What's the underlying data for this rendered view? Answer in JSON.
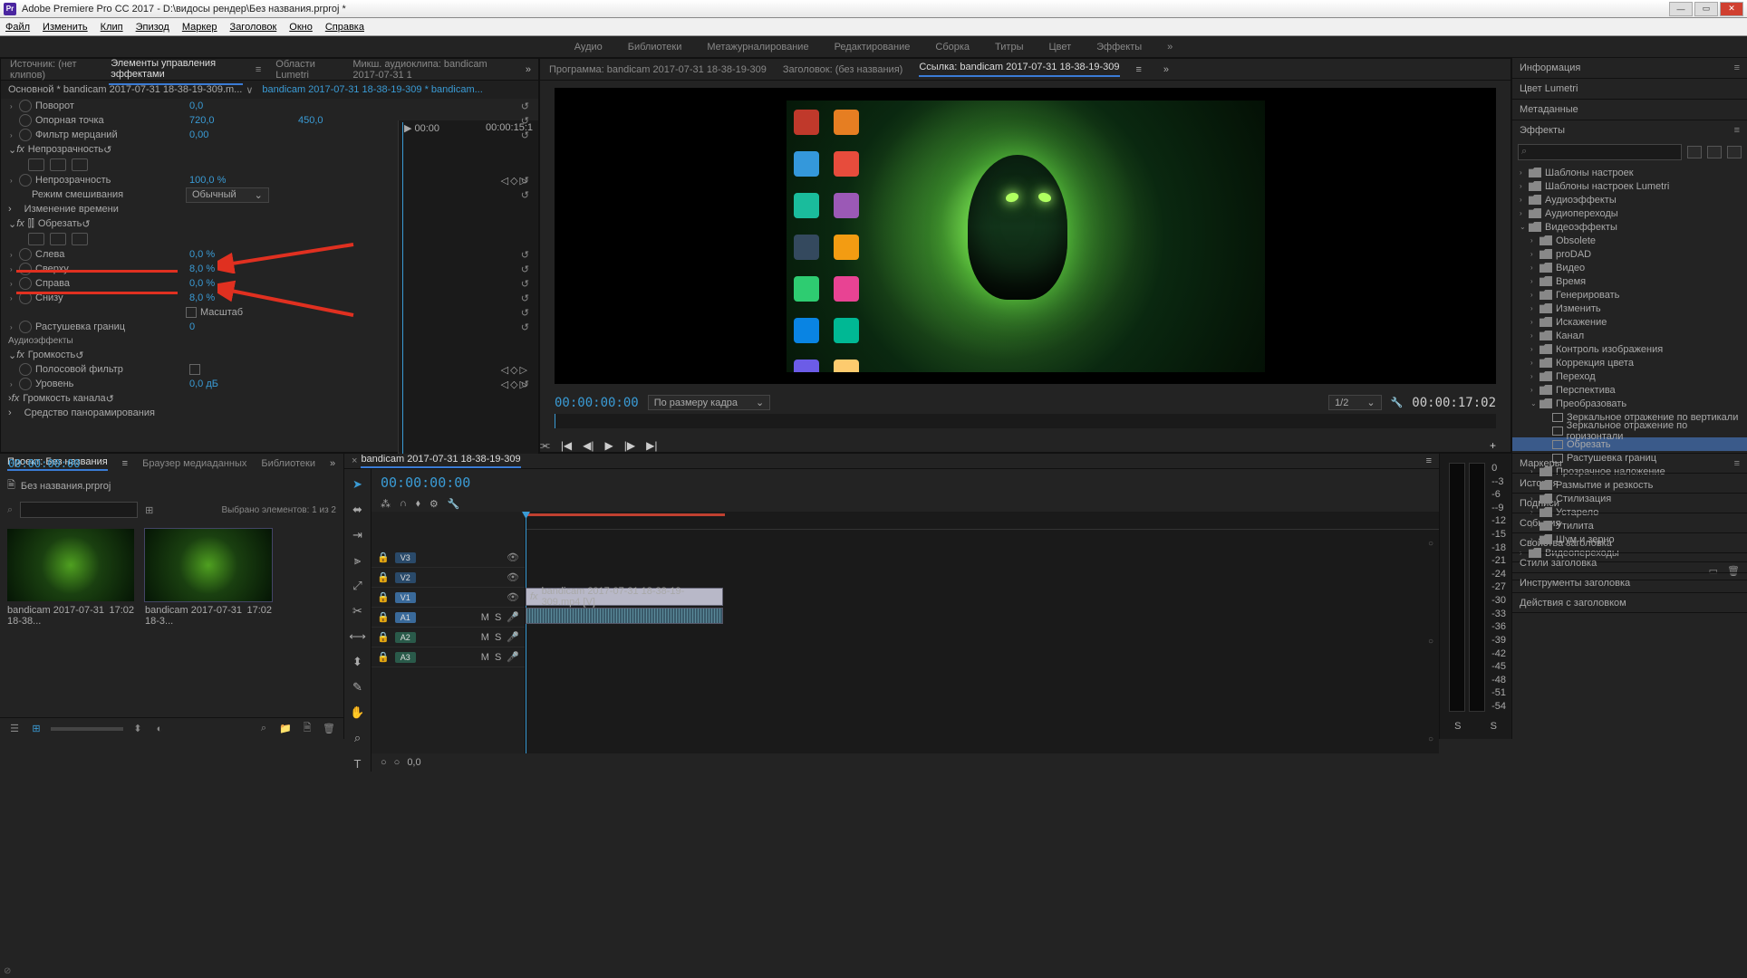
{
  "window": {
    "title": "Adobe Premiere Pro CC 2017 - D:\\видосы рендер\\Без названия.prproj *",
    "app_icon": "Pr"
  },
  "menu": [
    "Файл",
    "Изменить",
    "Клип",
    "Эпизод",
    "Маркер",
    "Заголовок",
    "Окно",
    "Справка"
  ],
  "workspaces": [
    "Аудио",
    "Библиотеки",
    "Метажурналирование",
    "Редактирование",
    "Сборка",
    "Титры",
    "Цвет",
    "Эффекты"
  ],
  "source_tabs": {
    "source": "Источник: (нет клипов)",
    "effects": "Элементы управления эффектами",
    "lumetri": "Области Lumetri",
    "mixer": "Микш. аудиоклипа: bandicam 2017-07-31 1"
  },
  "clip_header": {
    "master": "Основной * bandicam 2017-07-31 18-38-19-309.m...",
    "instance": "bandicam 2017-07-31 18-38-19-309 * bandicam..."
  },
  "timeline_mini": {
    "start": "00:00",
    "end": "00:00:15:1"
  },
  "effects": {
    "rotation": {
      "label": "Поворот",
      "value": "0,0"
    },
    "anchor": {
      "label": "Опорная точка",
      "value1": "720,0",
      "value2": "450,0"
    },
    "antiflicker": {
      "label": "Фильтр мерцаний",
      "value": "0,00"
    },
    "opacity_fx": "Непрозрачность",
    "opacity": {
      "label": "Непрозрачность",
      "value": "100,0 %"
    },
    "blend": {
      "label": "Режим смешивания",
      "value": "Обычный"
    },
    "time_remap": "Изменение времени",
    "crop_fx": "Обрезать",
    "crop": {
      "left": {
        "label": "Слева",
        "value": "0,0 %"
      },
      "top": {
        "label": "Сверху",
        "value": "8,0 %"
      },
      "right": {
        "label": "Справа",
        "value": "0,0 %"
      },
      "bottom": {
        "label": "Снизу",
        "value": "8,0 %"
      },
      "zoom": "Масштаб",
      "feather": {
        "label": "Растушевка границ",
        "value": "0"
      }
    },
    "audio_section": "Аудиоэффекты",
    "volume_fx": "Громкость",
    "bypass": "Полосовой фильтр",
    "level": {
      "label": "Уровень",
      "value": "0,0 дБ"
    },
    "channel_vol": "Громкость канала",
    "panner": "Средство панорамирования"
  },
  "source_timecode": "00:00:00:00",
  "program": {
    "tab1": "Программа: bandicam 2017-07-31 18-38-19-309",
    "tab2": "Заголовок: (без названия)",
    "tab3": "Ссылка: bandicam 2017-07-31 18-38-19-309",
    "tc_left": "00:00:00:00",
    "fit": "По размеру кадра",
    "res": "1/2",
    "tc_right": "00:00:17:02"
  },
  "right_tabs": [
    "Информация",
    "Цвет Lumetri",
    "Метаданные",
    "Эффекты"
  ],
  "effects_tree": {
    "presets": "Шаблоны настроек",
    "lumetri_presets": "Шаблоны настроек Lumetri",
    "audio_fx": "Аудиоэффекты",
    "audio_trans": "Аудиопереходы",
    "video_fx": "Видеоэффекты",
    "obsolete": "Obsolete",
    "prodad": "proDAD",
    "video": "Видео",
    "time": "Время",
    "generate": "Генерировать",
    "adjust": "Изменить",
    "distort": "Искажение",
    "channel": "Канал",
    "image_ctrl": "Контроль изображения",
    "color_corr": "Коррекция цвета",
    "transition": "Переход",
    "perspective": "Перспектива",
    "transform": "Преобразовать",
    "vflip": "Зеркальное отражение по вертикали",
    "hflip": "Зеркальное отражение по горизонтали",
    "crop": "Обрезать",
    "feather": "Растушевка границ",
    "transparent": "Прозрачное наложение",
    "blur": "Размытие и резкость",
    "stylize": "Стилизация",
    "deprecated": "Устарело",
    "utility": "Утилита",
    "noise": "Шум и зерно",
    "video_trans": "Видеопереходы"
  },
  "right_bottom": [
    "Маркеры",
    "История",
    "Подписи",
    "События",
    "Свойства заголовка",
    "Стили заголовка",
    "Инструменты заголовка",
    "Действия с заголовком"
  ],
  "project": {
    "tabs": [
      "Проект: Без названия",
      "Браузер медиаданных",
      "Библиотеки"
    ],
    "file": "Без названия.prproj",
    "status": "Выбрано элементов: 1 из 2",
    "item1": {
      "name": "bandicam 2017-07-31 18-38...",
      "dur": "17:02"
    },
    "item2": {
      "name": "bandicam 2017-07-31 18-3...",
      "dur": "17:02"
    }
  },
  "timeline": {
    "tab": "bandicam 2017-07-31 18-38-19-309",
    "tc": "00:00:00:00",
    "tracks_v": [
      "V3",
      "V2",
      "V1"
    ],
    "tracks_a": [
      "A1",
      "A2",
      "A3"
    ],
    "clip_name": "bandicam 2017-07-31 18-38-19-309.mp4 [V]",
    "footer_val": "0,0"
  },
  "meter_scale": [
    "0",
    "--3",
    "-6",
    "--9",
    "-12",
    "-15",
    "-18",
    "-21",
    "-24",
    "-27",
    "-30",
    "-33",
    "-36",
    "-39",
    "-42",
    "-45",
    "-48",
    "-51",
    "-54"
  ],
  "meter_labels": [
    "S",
    "S"
  ]
}
